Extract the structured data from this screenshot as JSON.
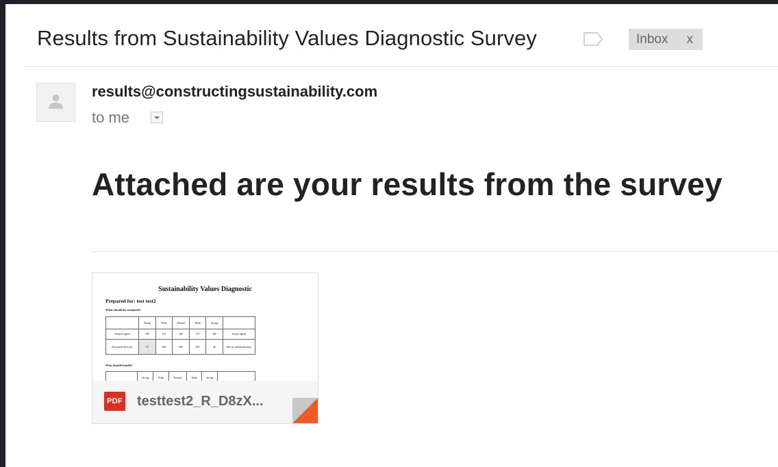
{
  "email": {
    "subject": "Results from Sustainability Values Diagnostic Survey",
    "label_chip": {
      "text": "Inbox",
      "remove": "x"
    },
    "sender": "results@constructingsustainability.com",
    "recipient": "to me",
    "headline": "Attached are your results from the survey"
  },
  "attachment": {
    "filename": "testtest2_R_D8zX...",
    "type_badge": "PDF",
    "preview": {
      "title": "Sustainability Values Diagnostic",
      "prepared_for": "Prepared for: test test2",
      "question1": "What should be sustained?",
      "table1": {
        "headers": [
          "",
          "Strong",
          "Weak",
          "Neutral",
          "Weak",
          "Strong",
          ""
        ],
        "rows": [
          [
            "Natural capital",
            "100",
            "270",
            "200",
            "170",
            "300",
            "Social capital"
          ],
          [
            "Ecosystem Services",
            "70",
            "260",
            "400",
            "200",
            "40",
            "Species and biodiversity"
          ]
        ]
      },
      "question2": "Who should benefit?",
      "table2": {
        "headers": [
          "",
          "Strong",
          "Weak",
          "Neutral",
          "Weak",
          "Strong",
          ""
        ]
      }
    }
  },
  "colors": {
    "frame": "#1f2229",
    "pdf_red": "#d93025",
    "chip_bg": "#dddddd",
    "corner_red": "#f05a28"
  },
  "icons": {
    "label": "label-tag-icon",
    "avatar": "person-icon",
    "details": "caret-down-icon",
    "pdf": "pdf-icon"
  }
}
